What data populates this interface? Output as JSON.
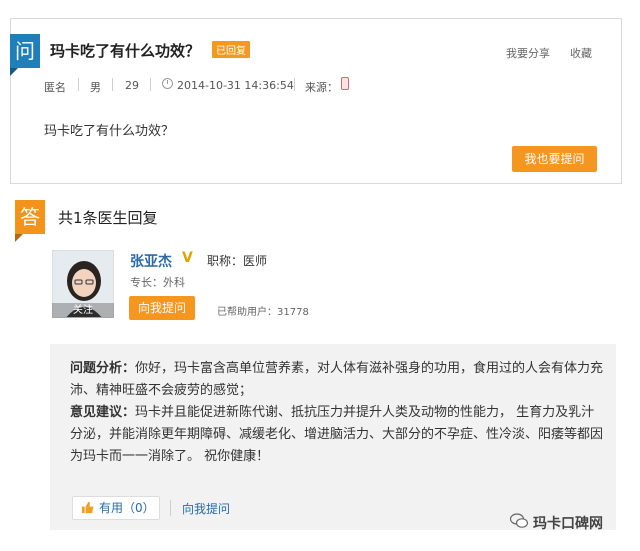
{
  "question": {
    "badge": "问",
    "title": "玛卡吃了有什么功效？",
    "status_tag": "已回复",
    "share_label": "我要分享",
    "favorite_label": "收藏",
    "meta": {
      "name": "匿名",
      "gender": "男",
      "age": "29",
      "time": "2014-10-31 14:36:54",
      "source_label": "来源："
    },
    "body": "玛卡吃了有什么功效？",
    "ask_button": "我也要提问"
  },
  "answers": {
    "badge": "答",
    "count_text": "共1条医生回复"
  },
  "doctor": {
    "name": "张亚杰",
    "verified": "V",
    "title": "职称：医师",
    "specialty": "专长：外科",
    "follow_label": "关注",
    "ask_button": "向我提问",
    "helped_users": "已帮助用户：31778"
  },
  "reply": {
    "analysis_label": "问题分析：",
    "analysis_text": "你好，玛卡富含高单位营养素，对人体有滋补强身的功用，食用过的人会有体力充沛、精神旺盛不会疲劳的感觉；",
    "advice_label": "意见建议：",
    "advice_text": "玛卡并且能促进新陈代谢、抵抗压力并提升人类及动物的性能力， 生育力及乳汁分泌，并能消除更年期障碍、减缓老化、增进脑活力、大部分的不孕症、性冷淡、阳痿等都因为玛卡而一一消除了。 祝你健康！",
    "useful_label": "有用（0）",
    "ask_link": "向我提问"
  },
  "watermark": {
    "text": "玛卡口碑网"
  },
  "colors": {
    "accent_orange": "#f5961e",
    "question_blue": "#1f7fb8",
    "link_blue": "#2a6aa6"
  }
}
